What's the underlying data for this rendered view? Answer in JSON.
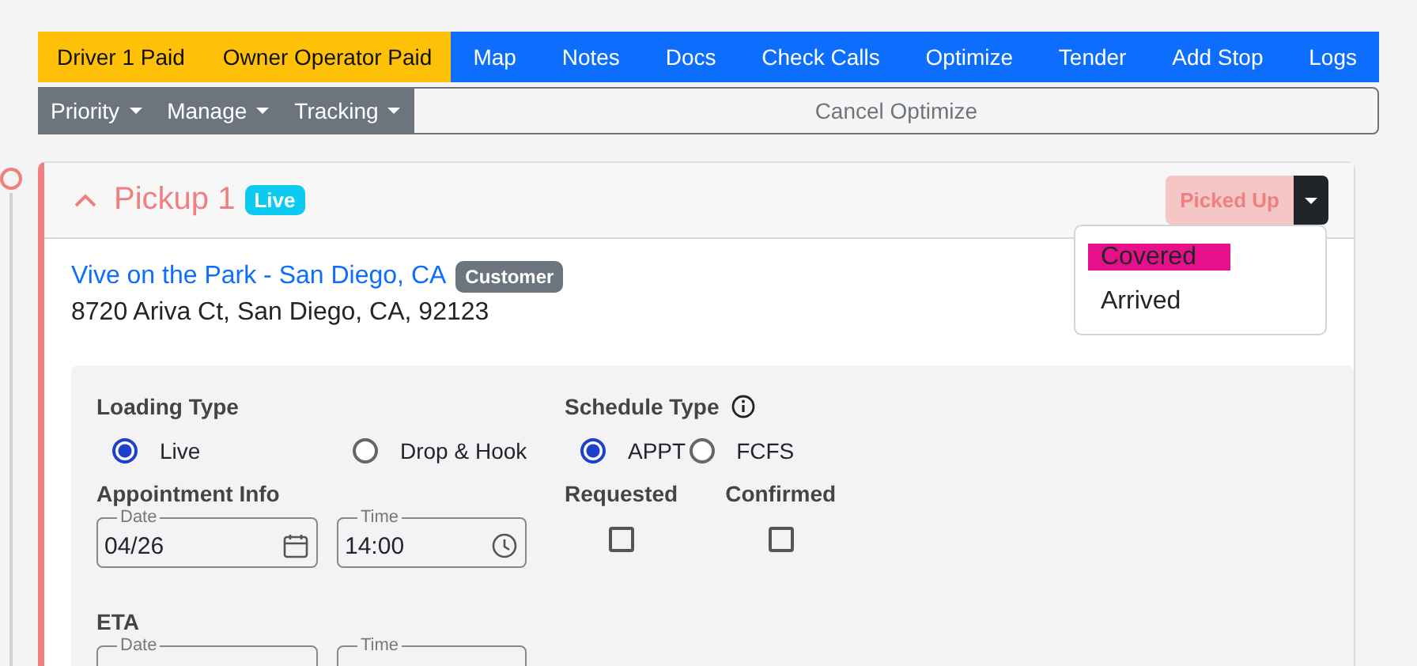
{
  "toolbar": {
    "status_buttons": [
      {
        "label": "Driver 1 Paid"
      },
      {
        "label": "Owner Operator Paid"
      }
    ],
    "action_buttons": [
      {
        "label": "Map"
      },
      {
        "label": "Notes"
      },
      {
        "label": "Docs"
      },
      {
        "label": "Check Calls"
      },
      {
        "label": "Optimize"
      },
      {
        "label": "Tender"
      },
      {
        "label": "Add Stop"
      },
      {
        "label": "Logs"
      }
    ],
    "dropdowns": [
      {
        "label": "Priority"
      },
      {
        "label": "Manage"
      },
      {
        "label": "Tracking"
      }
    ],
    "cancel_button": {
      "label": "Cancel Optimize"
    }
  },
  "stop": {
    "title": "Pickup 1",
    "expanded": true,
    "badge": "Live",
    "status_button": "Picked Up",
    "status_menu": [
      {
        "label": "Covered",
        "highlighted": true
      },
      {
        "label": "Arrived",
        "highlighted": false
      }
    ],
    "location": {
      "name": "Vive on the Park - San Diego, CA",
      "tag": "Customer",
      "address": "8720 Ariva Ct, San Diego, CA, 92123"
    },
    "loading_type": {
      "label": "Loading Type",
      "options": [
        {
          "label": "Live",
          "selected": true
        },
        {
          "label": "Drop & Hook",
          "selected": false
        }
      ]
    },
    "schedule_type": {
      "label": "Schedule Type",
      "options": [
        {
          "label": "APPT",
          "selected": true
        },
        {
          "label": "FCFS",
          "selected": false
        }
      ]
    },
    "appointment_info": {
      "label": "Appointment Info",
      "date": {
        "label": "Date",
        "value": "04/26"
      },
      "time": {
        "label": "Time",
        "value": "14:00"
      }
    },
    "checks": [
      {
        "label": "Requested",
        "checked": false
      },
      {
        "label": "Confirmed",
        "checked": false
      }
    ],
    "eta": {
      "label": "ETA",
      "date": {
        "label": "Date"
      },
      "time": {
        "label": "Time"
      }
    }
  }
}
